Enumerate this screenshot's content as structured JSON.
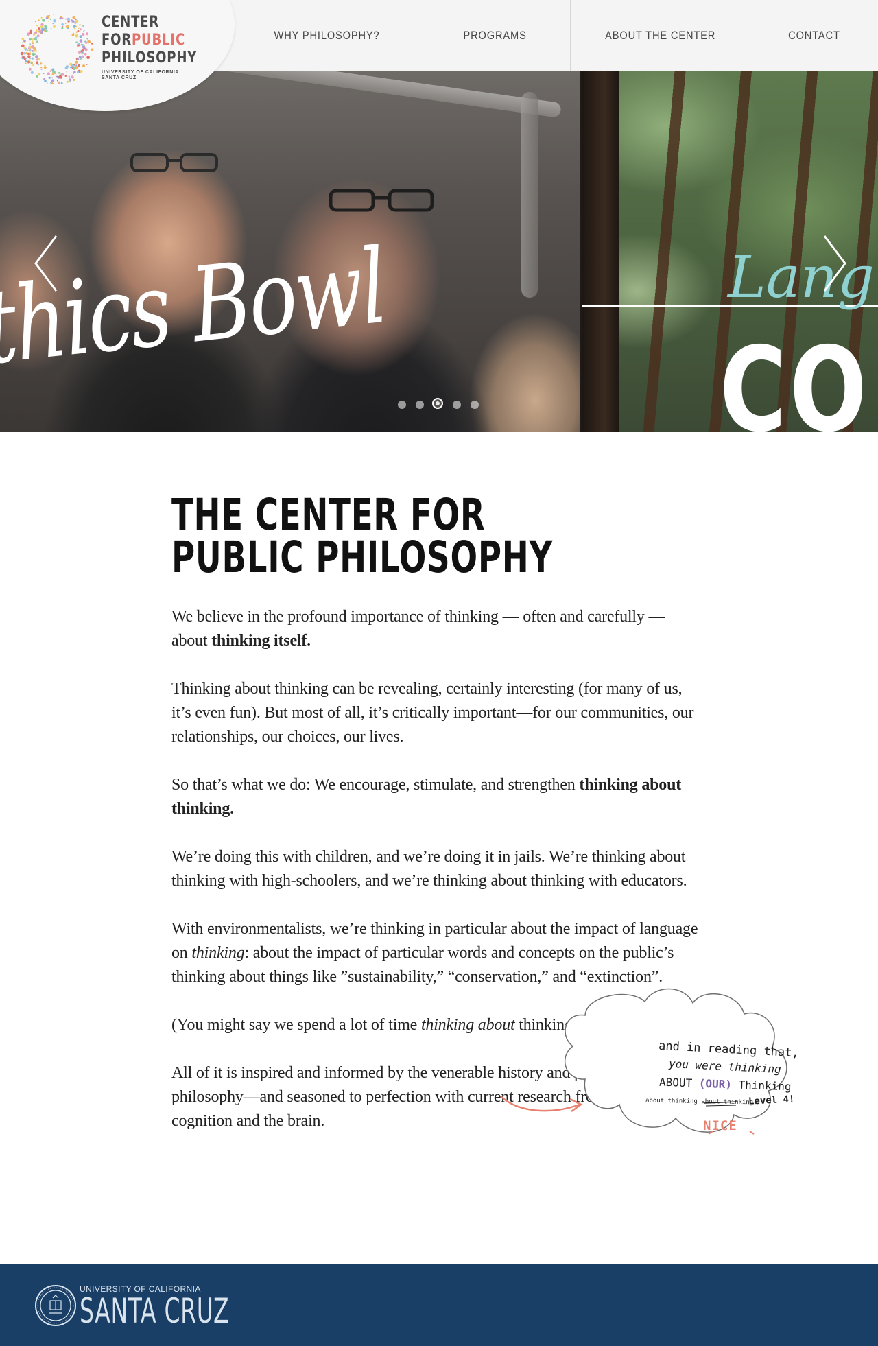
{
  "header": {
    "logo": {
      "line1": "CENTER",
      "line2_prefix": "FOR",
      "line2_accent": "PUBLIC",
      "line3": "PHILOSOPHY",
      "university_line1": "UNIVERSITY OF CALIFORNIA",
      "university_line2": "SANTA CRUZ"
    },
    "nav": [
      "WHY PHILOSOPHY?",
      "PROGRAMS",
      "ABOUT THE CENTER",
      "CONTACT"
    ]
  },
  "hero": {
    "slide1_text": "thics Bowl",
    "slide2_script": "Langua",
    "slide2_big": "CON",
    "active_slide_index": 2,
    "slide_count": 5
  },
  "main": {
    "title_line1": "THE CENTER FOR",
    "title_line2": "PUBLIC PHILOSOPHY",
    "p1_text": "We believe in the profound importance of thinking — often and carefully — about ",
    "p1_bold": "thinking itself.",
    "p2": "Thinking about thinking can be revealing, certainly interesting (for many of us, it’s even fun).  But most of all, it’s critically important—for our communities, our relationships, our choices, our lives.",
    "p3_text": "So that’s what we do: We encourage, stimulate, and strengthen ",
    "p3_bold": "thinking about thinking.",
    "p4": "We’re doing this with children, and we’re doing it in jails.  We’re thinking about thinking with high-schoolers, and we’re thinking about thinking with educators.",
    "p5_a": "With environmentalists, we’re thinking in particular about the impact of language on ",
    "p5_italic": "thinking",
    "p5_b": ": about the impact of particular words and concepts on the public’s thinking about things like ”sustainability,” “conservation,” and “extinction”.",
    "p6_a": "(You might say we spend a lot of time ",
    "p6_italic": "thinking about",
    "p6_b": " thinking about thinking.)",
    "p7": "All of it is inspired and informed by the venerable history and practice of philosophy—and seasoned to perfection with current research from the science of cognition and the brain."
  },
  "annotation": {
    "line1": "and in reading that,",
    "line2": "you were thinking",
    "line3_a": "ABOUT",
    "line3_b": "(OUR)",
    "line3_c": "Thinking",
    "line4_a": "about thinking about thinking.",
    "line4_b": "Level 4!",
    "line5": "NICE",
    "accent_color": "#e8806f",
    "purple_color": "#7a5fa6"
  },
  "footer": {
    "uc_small": "UNIVERSITY OF CALIFORNIA",
    "uc_big": "SANTA CRUZ"
  },
  "colors": {
    "accent": "#e3726b",
    "footer_bg": "#1a3f66",
    "header_bg": "#f4f4f4"
  }
}
